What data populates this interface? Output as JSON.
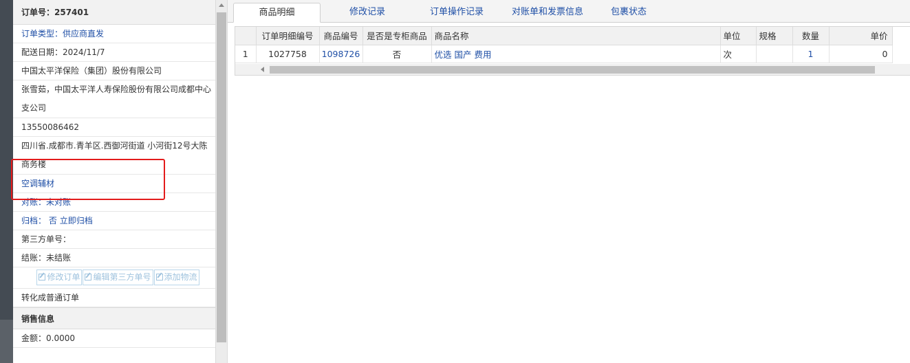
{
  "order": {
    "title": "订单号：257401",
    "type": "订单类型：供应商直发",
    "delivery_date": "配送日期：2024/11/7",
    "company": "中国太平洋保险（集团）股份有限公司",
    "contact": "张雪茹，中国太平洋人寿保险股份有限公司成都中心支公司",
    "phone": "13550086462",
    "address": "四川省.成都市.青羊区.西御河街道 小河街12号大陈商务楼",
    "category": "空调辅材",
    "reconcile": "对账：未对账",
    "archive_label": "归档：",
    "archive_value": "否",
    "archive_link": "立即归档",
    "third_party": "第三方单号：",
    "settle": "结账：未结账",
    "convert": "转化成普通订单"
  },
  "buttons": {
    "edit_order": "修改订单",
    "edit_third": "编辑第三方单号",
    "add_logistics": "添加物流"
  },
  "sales": {
    "title": "销售信息",
    "amount": "金额：0.0000"
  },
  "tabs": [
    "商品明细",
    "修改记录",
    "订单操作记录",
    "对账单和发票信息",
    "包裹状态"
  ],
  "table": {
    "headers": [
      "订单明细编号",
      "商品编号",
      "是否是专柜商品",
      "商品名称",
      "单位",
      "规格",
      "数量",
      "单价"
    ],
    "rows": [
      {
        "index": "1",
        "detail_id": "1027758",
        "product_id": "1098726",
        "counter": "否",
        "name": "优选 国产 费用",
        "unit": "次",
        "spec": "",
        "qty": "1",
        "price": "0"
      }
    ]
  },
  "colors": {
    "accent": "#1f4fa6",
    "highlight": "#e31b1b"
  },
  "icons": [
    "edit-icon",
    "arrow-up-icon",
    "arrow-left-icon"
  ]
}
